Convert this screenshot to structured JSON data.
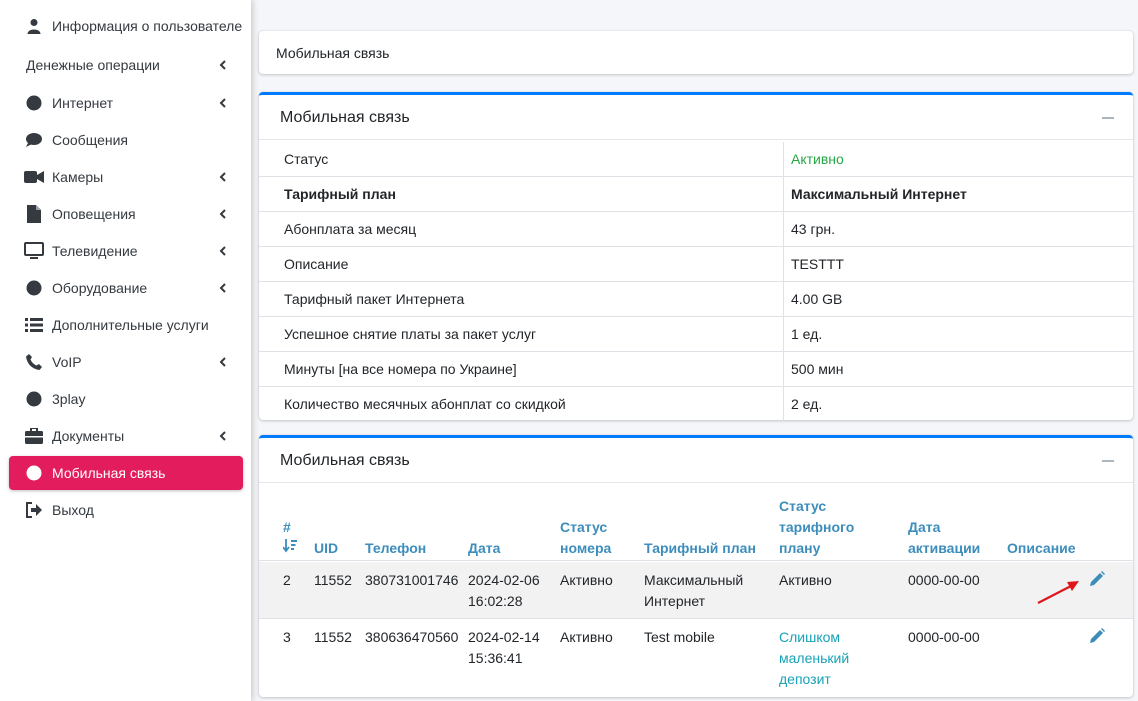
{
  "sidebar": {
    "items": [
      {
        "label": "Информация о пользователе",
        "icon": "user-icon",
        "active": false,
        "submenu": false
      },
      {
        "label": "Денежные операции",
        "icon": "",
        "active": false,
        "submenu": true
      },
      {
        "label": "Интернет",
        "icon": "circle-icon",
        "active": false,
        "submenu": true
      },
      {
        "label": "Сообщения",
        "icon": "comment-icon",
        "active": false,
        "submenu": false
      },
      {
        "label": "Камеры",
        "icon": "video-camera-icon",
        "active": false,
        "submenu": true
      },
      {
        "label": "Оповещения",
        "icon": "file-icon",
        "active": false,
        "submenu": true
      },
      {
        "label": "Телевидение",
        "icon": "tv-monitor-icon",
        "active": false,
        "submenu": true
      },
      {
        "label": "Оборудование",
        "icon": "circle-icon",
        "active": false,
        "submenu": true
      },
      {
        "label": "Дополнительные услуги",
        "icon": "list-icon",
        "active": false,
        "submenu": false
      },
      {
        "label": "VoIP",
        "icon": "phone-icon",
        "active": false,
        "submenu": true
      },
      {
        "label": "3play",
        "icon": "circle-icon",
        "active": false,
        "submenu": false
      },
      {
        "label": "Документы",
        "icon": "briefcase-icon",
        "active": false,
        "submenu": true
      },
      {
        "label": "Мобильная связь",
        "icon": "circle-icon",
        "active": true,
        "submenu": false
      },
      {
        "label": "Выход",
        "icon": "sign-out-icon",
        "active": false,
        "submenu": false
      }
    ]
  },
  "breadcrumb": {
    "title": "Мобильная связь"
  },
  "info_card": {
    "title": "Мобильная связь",
    "rows": [
      {
        "label": "Статус",
        "value": "Активно"
      },
      {
        "label": "Тарифный план",
        "value": "Максимальный Интернет"
      },
      {
        "label": "Абонплата за месяц",
        "value": "43 грн."
      },
      {
        "label": "Описание",
        "value": "TESTTT"
      },
      {
        "label": "Тарифный пакет Интернета",
        "value": "4.00 GB"
      },
      {
        "label": "Успешное снятие платы за пакет услуг",
        "value": "1 ед."
      },
      {
        "label": "Минуты [на все номера по Украине]",
        "value": "500 мин"
      },
      {
        "label": "Количество месячных абонплат со скидкой",
        "value": "2 ед."
      }
    ]
  },
  "list_card": {
    "title": "Мобильная связь",
    "headers": {
      "num": "#",
      "uid": "UID",
      "phone": "Телефон",
      "date": "Дата",
      "status_l1": "Статус",
      "status_l2": "номера",
      "tariff": "Тарифный план",
      "tstatus_l1": "Статус",
      "tstatus_l2": "тарифного",
      "tstatus_l3": "плану",
      "act_l1": "Дата",
      "act_l2": "активации",
      "desc": "Описание"
    },
    "rows": [
      {
        "num": "2",
        "uid": "11552",
        "phone": "380731001746",
        "date1": "2024-02-06",
        "date2": "16:02:28",
        "status": "Активно",
        "tariff1": "Максимальный",
        "tariff2": "Интернет",
        "tstatus1": "Активно",
        "tstatus2": "",
        "tstatus3": "",
        "activation": "0000-00-00",
        "desc": ""
      },
      {
        "num": "3",
        "uid": "11552",
        "phone": "380636470560",
        "date1": "2024-02-14",
        "date2": "15:36:41",
        "status": "Активно",
        "tariff1": "Test mobile",
        "tariff2": "",
        "tstatus1": "Слишком",
        "tstatus2": "маленький",
        "tstatus3": "депозит",
        "activation": "0000-00-00",
        "desc": ""
      }
    ]
  },
  "colors": {
    "active_nav": "#e21c5d",
    "card_outline": "#007bff",
    "header_link": "#3c8dbc",
    "status_active": "#28a745",
    "status_warning": "#17a2b8",
    "annotation_arrow": "#e0161b"
  }
}
